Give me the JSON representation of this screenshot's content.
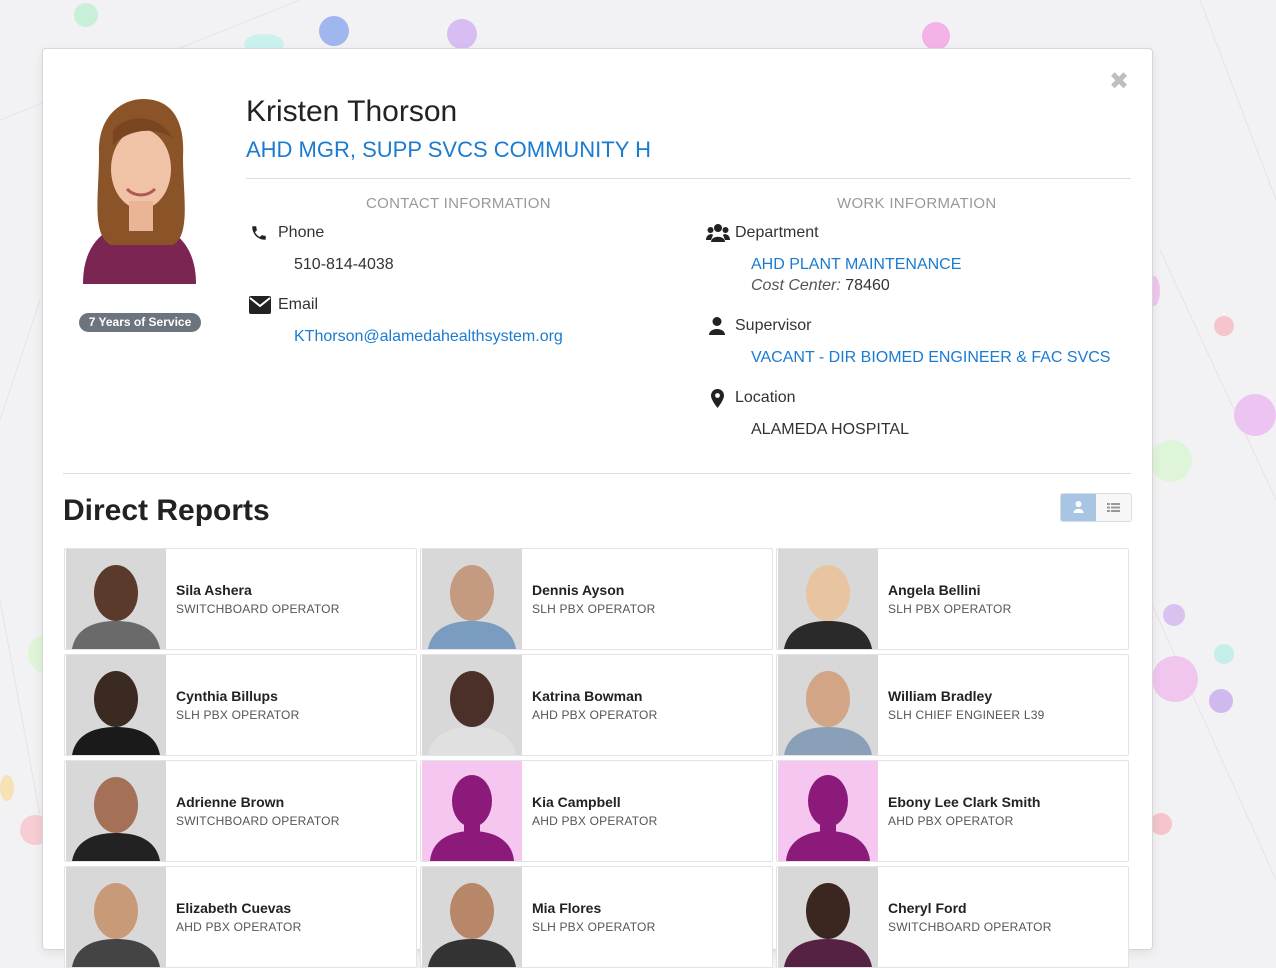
{
  "profile": {
    "name": "Kristen Thorson",
    "job_title": "AHD MGR, SUPP SVCS COMMUNITY H",
    "service_badge": "7 Years of Service"
  },
  "contact": {
    "heading": "CONTACT INFORMATION",
    "phone_label": "Phone",
    "phone_value": "510-814-4038",
    "email_label": "Email",
    "email_value": "KThorson@alamedahealthsystem.org"
  },
  "work": {
    "heading": "WORK INFORMATION",
    "department_label": "Department",
    "department_value": "AHD PLANT MAINTENANCE",
    "cost_center_label": "Cost Center:",
    "cost_center_value": "78460",
    "supervisor_label": "Supervisor",
    "supervisor_value": "VACANT - DIR BIOMED ENGINEER & FAC SVCS",
    "location_label": "Location",
    "location_value": "ALAMEDA HOSPITAL"
  },
  "direct_reports": {
    "heading": "Direct Reports",
    "people": [
      {
        "name": "Sila Ashera",
        "role": "SWITCHBOARD OPERATOR",
        "photo": "person-photo"
      },
      {
        "name": "Dennis Ayson",
        "role": "SLH PBX OPERATOR",
        "photo": "person-photo"
      },
      {
        "name": "Angela Bellini",
        "role": "SLH PBX OPERATOR",
        "photo": "person-photo"
      },
      {
        "name": "Cynthia Billups",
        "role": "SLH PBX OPERATOR",
        "photo": "person-photo"
      },
      {
        "name": "Katrina Bowman",
        "role": "AHD PBX OPERATOR",
        "photo": "person-photo"
      },
      {
        "name": "William Bradley",
        "role": "SLH CHIEF ENGINEER L39",
        "photo": "person-photo"
      },
      {
        "name": "Adrienne Brown",
        "role": "SWITCHBOARD OPERATOR",
        "photo": "person-photo"
      },
      {
        "name": "Kia Campbell",
        "role": "AHD PBX OPERATOR",
        "photo": "placeholder-silhouette"
      },
      {
        "name": "Ebony Lee Clark Smith",
        "role": "AHD PBX OPERATOR",
        "photo": "placeholder-silhouette"
      },
      {
        "name": "Elizabeth Cuevas",
        "role": "AHD PBX OPERATOR",
        "photo": "person-photo"
      },
      {
        "name": "Mia Flores",
        "role": "SLH PBX OPERATOR",
        "photo": "person-photo"
      },
      {
        "name": "Cheryl Ford",
        "role": "SWITCHBOARD OPERATOR",
        "photo": "person-photo"
      }
    ]
  },
  "icons": [
    "close-icon",
    "phone-icon",
    "email-icon",
    "department-icon",
    "supervisor-icon",
    "location-icon",
    "card-view-icon",
    "list-view-icon"
  ],
  "colors": {
    "accent": "#1a7bd1",
    "badge": "#6c757d",
    "placeholder_bg": "#f5c6f0",
    "placeholder_fg": "#8b1a7a"
  }
}
